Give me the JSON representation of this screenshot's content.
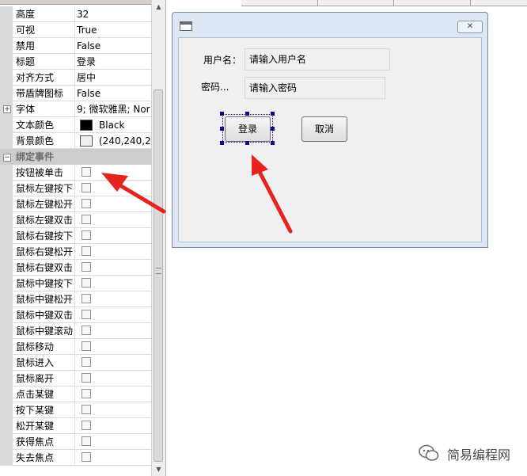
{
  "property_grid": {
    "rows": [
      {
        "name": "高度",
        "value": "32"
      },
      {
        "name": "可视",
        "value": "True"
      },
      {
        "name": "禁用",
        "value": "False"
      },
      {
        "name": "标题",
        "value": "登录"
      },
      {
        "name": "对齐方式",
        "value": "居中"
      },
      {
        "name": "带盾牌图标",
        "value": "False"
      },
      {
        "name": "字体",
        "value": "9; 微软雅黑; Nor"
      },
      {
        "name": "文本颜色",
        "value": "Black",
        "color": "#000000"
      },
      {
        "name": "背景颜色",
        "value": "(240,240,24",
        "color": "#f0f0f0"
      }
    ],
    "event_category": "绑定事件",
    "events": [
      {
        "name": "按钮被单击",
        "checked": false
      },
      {
        "name": "鼠标左键按下",
        "checked": false
      },
      {
        "name": "鼠标左键松开",
        "checked": false
      },
      {
        "name": "鼠标左键双击",
        "checked": false
      },
      {
        "name": "鼠标右键按下",
        "checked": false
      },
      {
        "name": "鼠标右键松开",
        "checked": false
      },
      {
        "name": "鼠标右键双击",
        "checked": false
      },
      {
        "name": "鼠标中键按下",
        "checked": false
      },
      {
        "name": "鼠标中键松开",
        "checked": false
      },
      {
        "name": "鼠标中键双击",
        "checked": false
      },
      {
        "name": "鼠标中键滚动",
        "checked": false
      },
      {
        "name": "鼠标移动",
        "checked": false
      },
      {
        "name": "鼠标进入",
        "checked": false
      },
      {
        "name": "鼠标离开",
        "checked": false
      },
      {
        "name": "点击某键",
        "checked": false
      },
      {
        "name": "按下某键",
        "checked": false
      },
      {
        "name": "松开某键",
        "checked": false
      },
      {
        "name": "获得焦点",
        "checked": false
      },
      {
        "name": "失去焦点",
        "checked": false
      }
    ]
  },
  "form": {
    "close_glyph": "✕",
    "username_label": "用户名：",
    "username_placeholder": "请输入用户名",
    "password_label": "密码...",
    "password_placeholder": "请输入密码",
    "login_button": "登录",
    "cancel_button": "取消"
  },
  "watermark": {
    "text": "简易编程网"
  },
  "colors": {
    "annotation_arrow": "#e8231f",
    "selection_handle": "#0a0a8a"
  }
}
